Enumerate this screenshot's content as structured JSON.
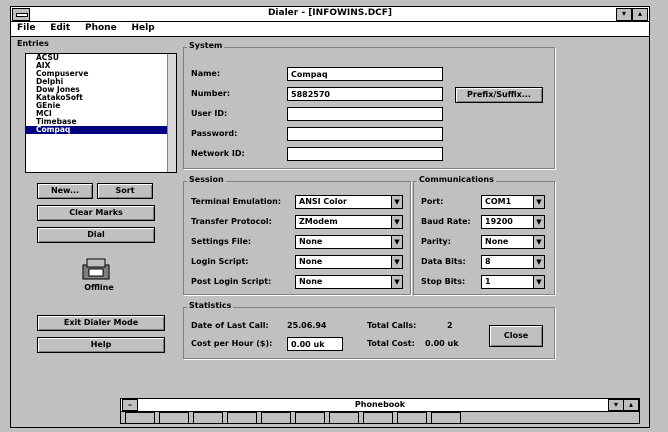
{
  "window": {
    "title": "Dialer - [INFOWINS.DCF]"
  },
  "menu": [
    "File",
    "Edit",
    "Phone",
    "Help"
  ],
  "entries": {
    "label": "Entries",
    "items": [
      "ACSU",
      "AIX",
      "Compuserve",
      "Delphi",
      "Dow Jones",
      "KatakoSoft",
      "GEnie",
      "MCI",
      "Timebase",
      "Compaq"
    ],
    "selected": "Compaq"
  },
  "buttons": {
    "new": "New...",
    "sort": "Sort",
    "clear_marks": "Clear Marks",
    "dial": "Dial",
    "exit_dialer": "Exit Dialer Mode",
    "help": "Help",
    "prefix_suffix": "Prefix/Suffix...",
    "close": "Close"
  },
  "status_icon_label": "Offline",
  "system": {
    "label": "System",
    "name_label": "Name:",
    "name": "Compaq",
    "number_label": "Number:",
    "number": "5882570",
    "userid_label": "User ID:",
    "userid": "",
    "password_label": "Password:",
    "password": "",
    "netid_label": "Network ID:",
    "netid": ""
  },
  "session": {
    "label": "Session",
    "emulation_label": "Terminal Emulation:",
    "emulation": "ANSI Color",
    "protocol_label": "Transfer Protocol:",
    "protocol": "ZModem",
    "settings_label": "Settings File:",
    "settings": "None",
    "login_label": "Login Script:",
    "login": "None",
    "postlogin_label": "Post Login Script:",
    "postlogin": "None"
  },
  "comm": {
    "label": "Communications",
    "port_label": "Port:",
    "port": "COM1",
    "baud_label": "Baud Rate:",
    "baud": "19200",
    "parity_label": "Parity:",
    "parity": "None",
    "databits_label": "Data Bits:",
    "databits": "8",
    "stopbits_label": "Stop Bits:",
    "stopbits": "1"
  },
  "stats": {
    "label": "Statistics",
    "last_call_label": "Date of Last Call:",
    "last_call": "25.06.94",
    "cost_label": "Cost per Hour ($):",
    "cost": "0.00 uk",
    "total_calls_label": "Total Calls:",
    "total_calls": "2",
    "total_cost_label": "Total Cost:",
    "total_cost": "0.00 uk"
  },
  "phonebar": {
    "title": "Phonebook",
    "tools": [
      "",
      "",
      "",
      "",
      "",
      "",
      "",
      "",
      "",
      ""
    ]
  }
}
